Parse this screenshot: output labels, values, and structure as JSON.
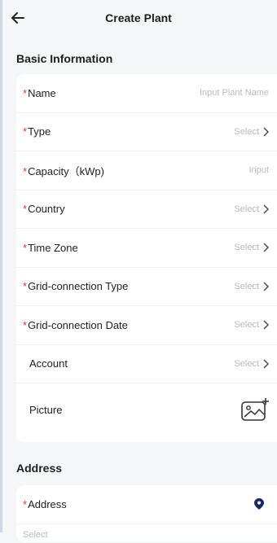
{
  "header": {
    "title": "Create Plant"
  },
  "sections": {
    "basic": "Basic Information",
    "address": "Address"
  },
  "fields": [
    {
      "label": "Name",
      "required": true,
      "value": "Input Plant Name",
      "chevron": false
    },
    {
      "label": "Type",
      "required": true,
      "value": "Select",
      "chevron": true
    },
    {
      "label": "Capacity（kWp)",
      "required": true,
      "value": "Input",
      "chevron": false
    },
    {
      "label": "Country",
      "required": true,
      "value": "Select",
      "chevron": true
    },
    {
      "label": "Time Zone",
      "required": true,
      "value": "Select",
      "chevron": true
    },
    {
      "label": "Grid-connection Type",
      "required": true,
      "value": "Select",
      "chevron": true
    },
    {
      "label": "Grid-connection Date",
      "required": true,
      "value": "Select",
      "chevron": true
    },
    {
      "label": "Account",
      "required": false,
      "value": "Select",
      "chevron": true
    },
    {
      "label": "Picture",
      "required": false,
      "icon": "add-picture-icon"
    }
  ],
  "address": {
    "label": "Address",
    "required": true,
    "icon": "location-pin-icon",
    "next_value": "Select"
  },
  "colors": {
    "required": "#e53935",
    "accent": "#1b2a5e",
    "placeholder": "#b9b9b9"
  }
}
